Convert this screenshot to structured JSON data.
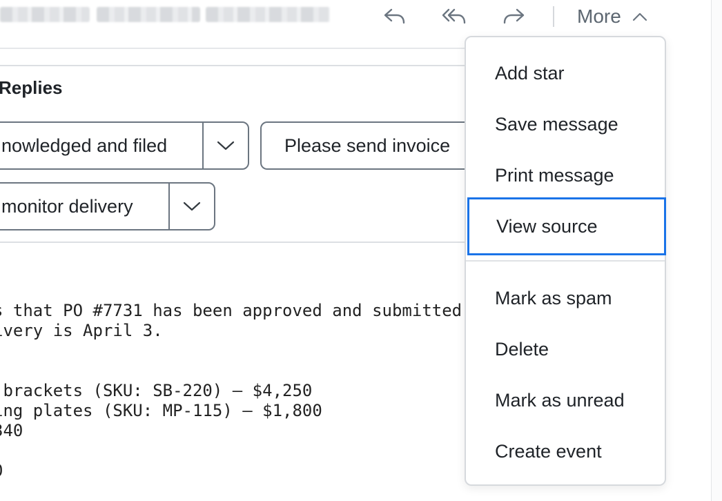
{
  "toolbar": {
    "reply_icon": "reply-icon",
    "reply_all_icon": "reply-all-icon",
    "forward_icon": "forward-icon",
    "more_label": "More",
    "more_icon": "chevron-up-icon",
    "icon_color": "#6b7580"
  },
  "replies": {
    "title": "Replies",
    "buttons": [
      {
        "label": "nowledged and filed",
        "has_dropdown": true
      },
      {
        "label": "Please send invoice",
        "has_dropdown": false
      },
      {
        "label": "monitor delivery",
        "has_dropdown": true
      }
    ]
  },
  "message": {
    "lines": [
      "s that PO #7731 has been approved and submitted",
      "ivery is April 3.",
      "",
      "",
      " brackets (SKU: SB-220) — $4,250",
      "ing plates (SKU: MP-115) — $1,800",
      "340",
      "",
      "0"
    ]
  },
  "menu": {
    "items": [
      {
        "label": "Add star"
      },
      {
        "label": "Save message"
      },
      {
        "label": "Print message"
      },
      {
        "label": "View source",
        "focused": true
      },
      {
        "label": "Mark as spam"
      },
      {
        "label": "Delete"
      },
      {
        "label": "Mark as unread"
      },
      {
        "label": "Create event"
      }
    ],
    "focus_color": "#1a73e8"
  }
}
